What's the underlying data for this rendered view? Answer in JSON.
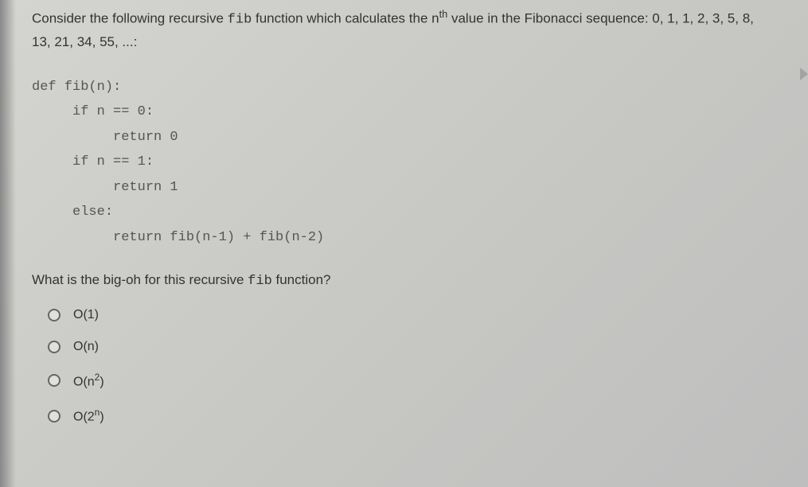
{
  "intro": {
    "part1": "Consider the following recursive ",
    "code1": "fib",
    "part2": " function which calculates the n",
    "sup": "th",
    "part3": " value in the Fibonacci sequence: 0, 1, 1, 2, 3, 5, 8, 13, 21, 34, 55, ...:"
  },
  "code": "def fib(n):\n     if n == 0:\n          return 0\n     if n == 1:\n          return 1\n     else:\n          return fib(n-1) + fib(n-2)",
  "subq": {
    "part1": "What is the big-oh for this recursive ",
    "code1": "fib",
    "part2": " function?"
  },
  "options": [
    {
      "label": "O(1)"
    },
    {
      "label": "O(n)"
    },
    {
      "label_html": "O(n<sup>2</sup>)"
    },
    {
      "label_html": "O(2<sup>n</sup>)"
    }
  ]
}
